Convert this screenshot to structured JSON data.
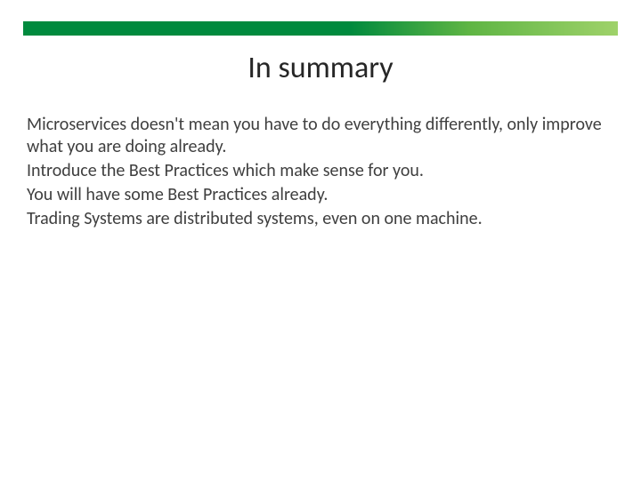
{
  "title": "In summary",
  "body": {
    "p1": "Microservices doesn't mean you have to do everything differently, only improve what you are doing already.",
    "p2": "Introduce the Best Practices which make sense for you.",
    "p3": "You will have some Best Practices already.",
    "p4": "Trading Systems are distributed systems, even on one machine."
  }
}
